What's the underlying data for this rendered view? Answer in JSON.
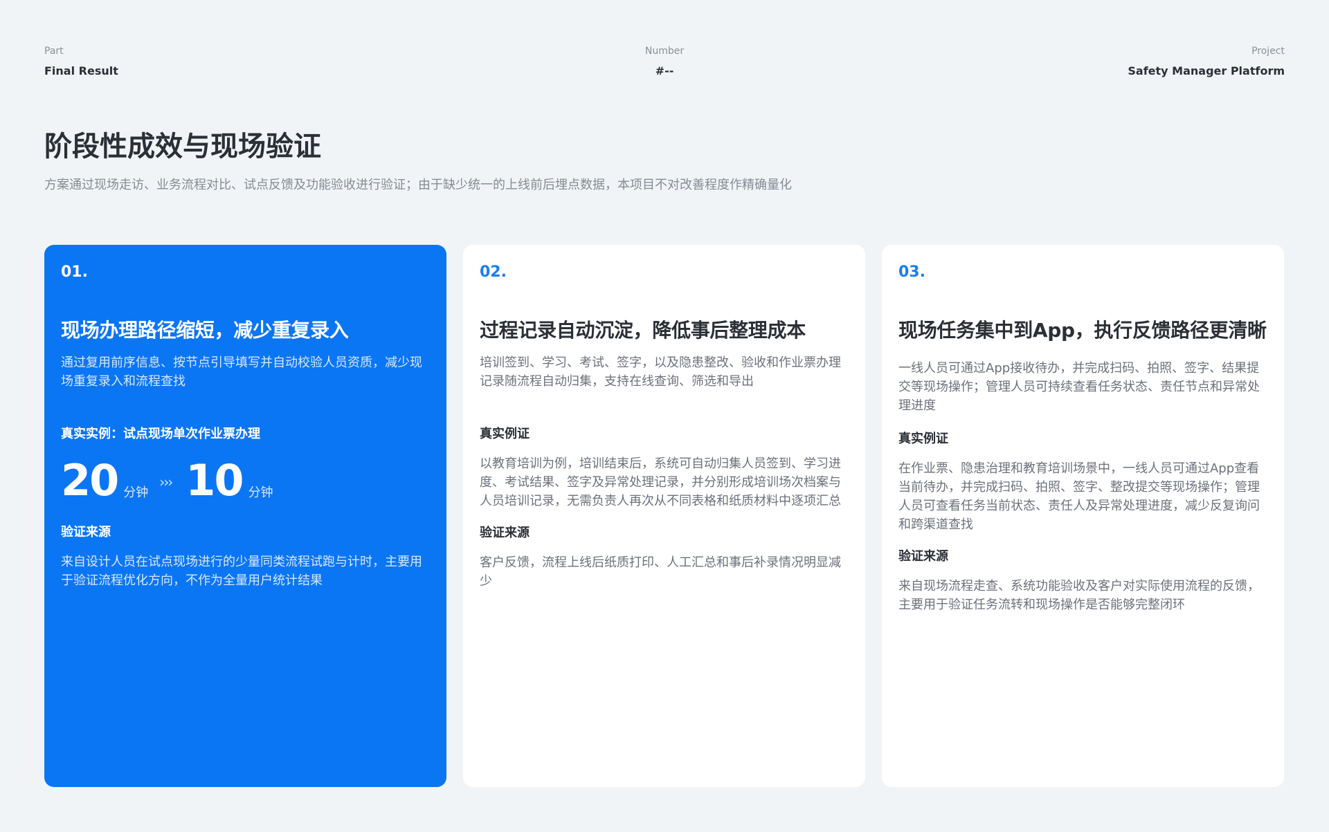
{
  "meta": {
    "part_label": "Part",
    "part_value": "Final Result",
    "number_label": "Number",
    "number_value": "#--",
    "project_label": "Project",
    "project_value": "Safety Manager Platform"
  },
  "title": "阶段性成效与现场验证",
  "subtitle": "方案通过现场走访、业务流程对比、试点反馈及功能验收进行验证；由于缺少统一的上线前后埋点数据，本项目不对改善程度作精确量化",
  "cards": [
    {
      "num": "01.",
      "heading": "现场办理路径缩短，减少重复录入",
      "desc": "通过复用前序信息、按节点引导填写并自动校验人员资质，减少现场重复录入和流程查找",
      "example_label": "真实实例：试点现场单次作业票办理",
      "metric": {
        "before_value": "20",
        "before_unit": "分钟",
        "arrow": "›››",
        "after_value": "10",
        "after_unit": "分钟"
      },
      "source_label": "验证来源",
      "source_text": "来自设计人员在试点现场进行的少量同类流程试跑与计时，主要用于验证流程优化方向，不作为全量用户统计结果"
    },
    {
      "num": "02.",
      "heading": "过程记录自动沉淀，降低事后整理成本",
      "desc": "培训签到、学习、考试、签字，以及隐患整改、验收和作业票办理记录随流程自动归集，支持在线查询、筛选和导出",
      "example_label": "真实例证",
      "example_text": "以教育培训为例，培训结束后，系统可自动归集人员签到、学习进度、考试结果、签字及异常处理记录，并分别形成培训场次档案与人员培训记录，无需负责人再次从不同表格和纸质材料中逐项汇总",
      "source_label": "验证来源",
      "source_text": "客户反馈，流程上线后纸质打印、人工汇总和事后补录情况明显减少"
    },
    {
      "num": "03.",
      "heading": "现场任务集中到App，执行反馈路径更清晰",
      "desc": "一线人员可通过App接收待办，并完成扫码、拍照、签字、结果提交等现场操作；管理人员可持续查看任务状态、责任节点和异常处理进度",
      "example_label": "真实例证",
      "example_text": "在作业票、隐患治理和教育培训场景中，一线人员可通过App查看当前待办，并完成扫码、拍照、签字、整改提交等现场操作；管理人员可查看任务当前状态、责任人及异常处理进度，减少反复询问和跨渠道查找",
      "source_label": "验证来源",
      "source_text": "来自现场流程走查、系统功能验收及客户对实际使用流程的反馈，主要用于验证任务流转和现场操作是否能够完整闭环"
    }
  ]
}
